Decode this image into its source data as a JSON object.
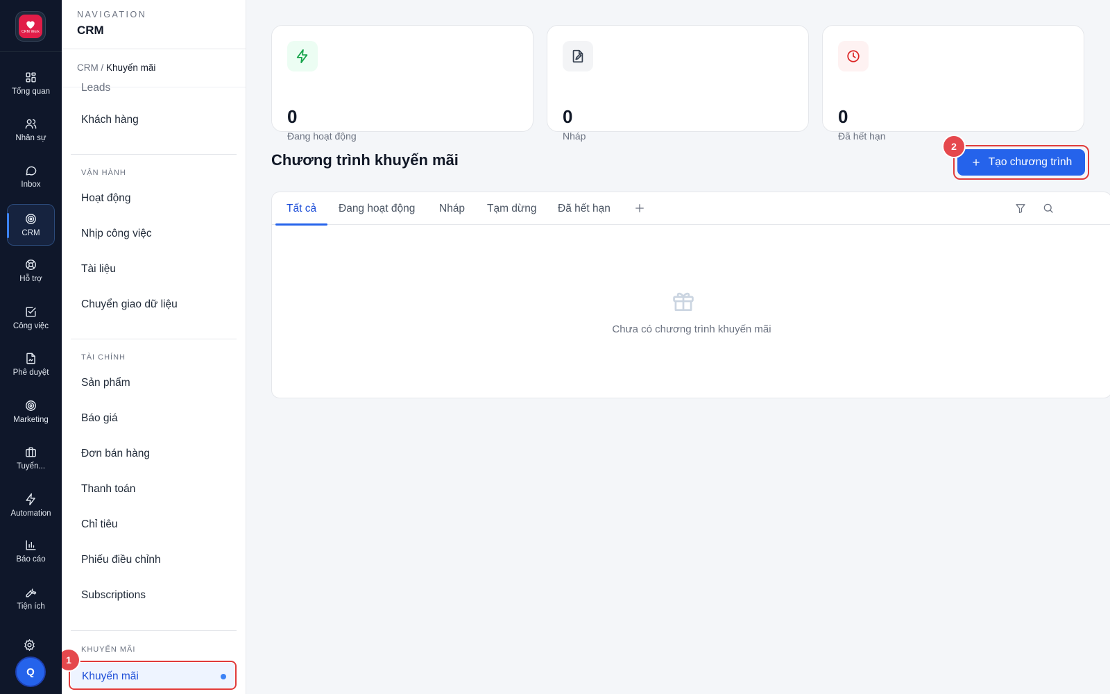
{
  "rail": {
    "logo_text": "CRM Work",
    "items": [
      {
        "label": "Tổng quan",
        "icon": "dashboard-icon"
      },
      {
        "label": "Nhân sự",
        "icon": "users-icon"
      },
      {
        "label": "Inbox",
        "icon": "chat-icon"
      },
      {
        "label": "CRM",
        "icon": "target-icon",
        "active": true
      },
      {
        "label": "Hỗ trợ",
        "icon": "lifebuoy-icon"
      },
      {
        "label": "Công việc",
        "icon": "checkbox-icon"
      },
      {
        "label": "Phê duyệt",
        "icon": "document-sign-icon"
      },
      {
        "label": "Marketing",
        "icon": "target-icon"
      },
      {
        "label": "Tuyển...",
        "icon": "briefcase-icon"
      },
      {
        "label": "Automation",
        "icon": "bolt-icon"
      },
      {
        "label": "Báo cáo",
        "icon": "bar-chart-icon"
      },
      {
        "label": "Tiện ích",
        "icon": "wrench-icon"
      }
    ],
    "avatar_initial": "Q"
  },
  "nav": {
    "eyebrow": "NAVIGATION",
    "title": "CRM",
    "breadcrumb_root": "CRM",
    "breadcrumb_sep": "/",
    "breadcrumb_current": "Khuyến mãi",
    "cut_item": "Leads",
    "item_customers": "Khách hàng",
    "section_ops": "VẬN HÀNH",
    "ops": [
      "Hoạt động",
      "Nhịp công việc",
      "Tài liệu",
      "Chuyển giao dữ liệu"
    ],
    "section_finance": "TÀI CHÍNH",
    "finance": [
      "Sản phẩm",
      "Báo giá",
      "Đơn bán hàng",
      "Thanh toán",
      "Chỉ tiêu",
      "Phiếu điều chỉnh",
      "Subscriptions"
    ],
    "section_promo": "KHUYẾN MÃI",
    "active_item": "Khuyến mãi"
  },
  "annotations": {
    "badge_1": "1",
    "badge_2": "2"
  },
  "stats": [
    {
      "value": "0",
      "label": "Đang hoạt động",
      "icon": "bolt-icon",
      "color": "#16a34a",
      "bg": "#ecfdf3"
    },
    {
      "value": "0",
      "label": "Nháp",
      "icon": "document-edit-icon",
      "color": "#374151",
      "bg": "#f3f4f6"
    },
    {
      "value": "0",
      "label": "Đã hết hạn",
      "icon": "clock-icon",
      "color": "#dc2626",
      "bg": "#fef2f2"
    }
  ],
  "main": {
    "title": "Chương trình khuyến mãi",
    "create_label": "Tạo chương trình",
    "tabs": [
      "Tất cả",
      "Đang hoạt động",
      "Nháp",
      "Tạm dừng",
      "Đã hết hạn"
    ],
    "empty_text": "Chưa có chương trình khuyến mãi"
  },
  "colors": {
    "accent": "#2563eb",
    "highlight": "#e03b3b",
    "rail_bg": "#0f172a"
  }
}
